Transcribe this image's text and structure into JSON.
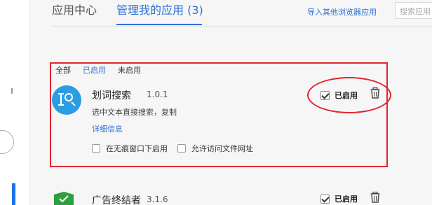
{
  "header": {
    "tabs": [
      {
        "label": "应用中心"
      },
      {
        "label": "管理我的应用 (3)"
      }
    ],
    "import_link": "导入其他浏览器应用",
    "search_placeholder": "搜索应用"
  },
  "filters": {
    "all": "全部",
    "enabled": "已启用",
    "disabled": "未启用"
  },
  "extensions": [
    {
      "name": "划词搜索",
      "version": "1.0.1",
      "description": "选中文本直接搜索，复制",
      "details_link": "详细信息",
      "enabled_label": "已启用",
      "enabled": true,
      "options": {
        "incognito": "在无痕窗口下启用",
        "file_url": "允许访问文件网址"
      },
      "icon": "magnifier-text-icon",
      "icon_color": "#2a9de3"
    },
    {
      "name": "广告终结者",
      "version": "3.1.6",
      "enabled_label": "已启用",
      "enabled": true,
      "icon": "shield-icon",
      "icon_color": "#2e9e3e"
    }
  ],
  "colors": {
    "accent": "#2b6fd6",
    "annotation_red": "#e0262f"
  }
}
